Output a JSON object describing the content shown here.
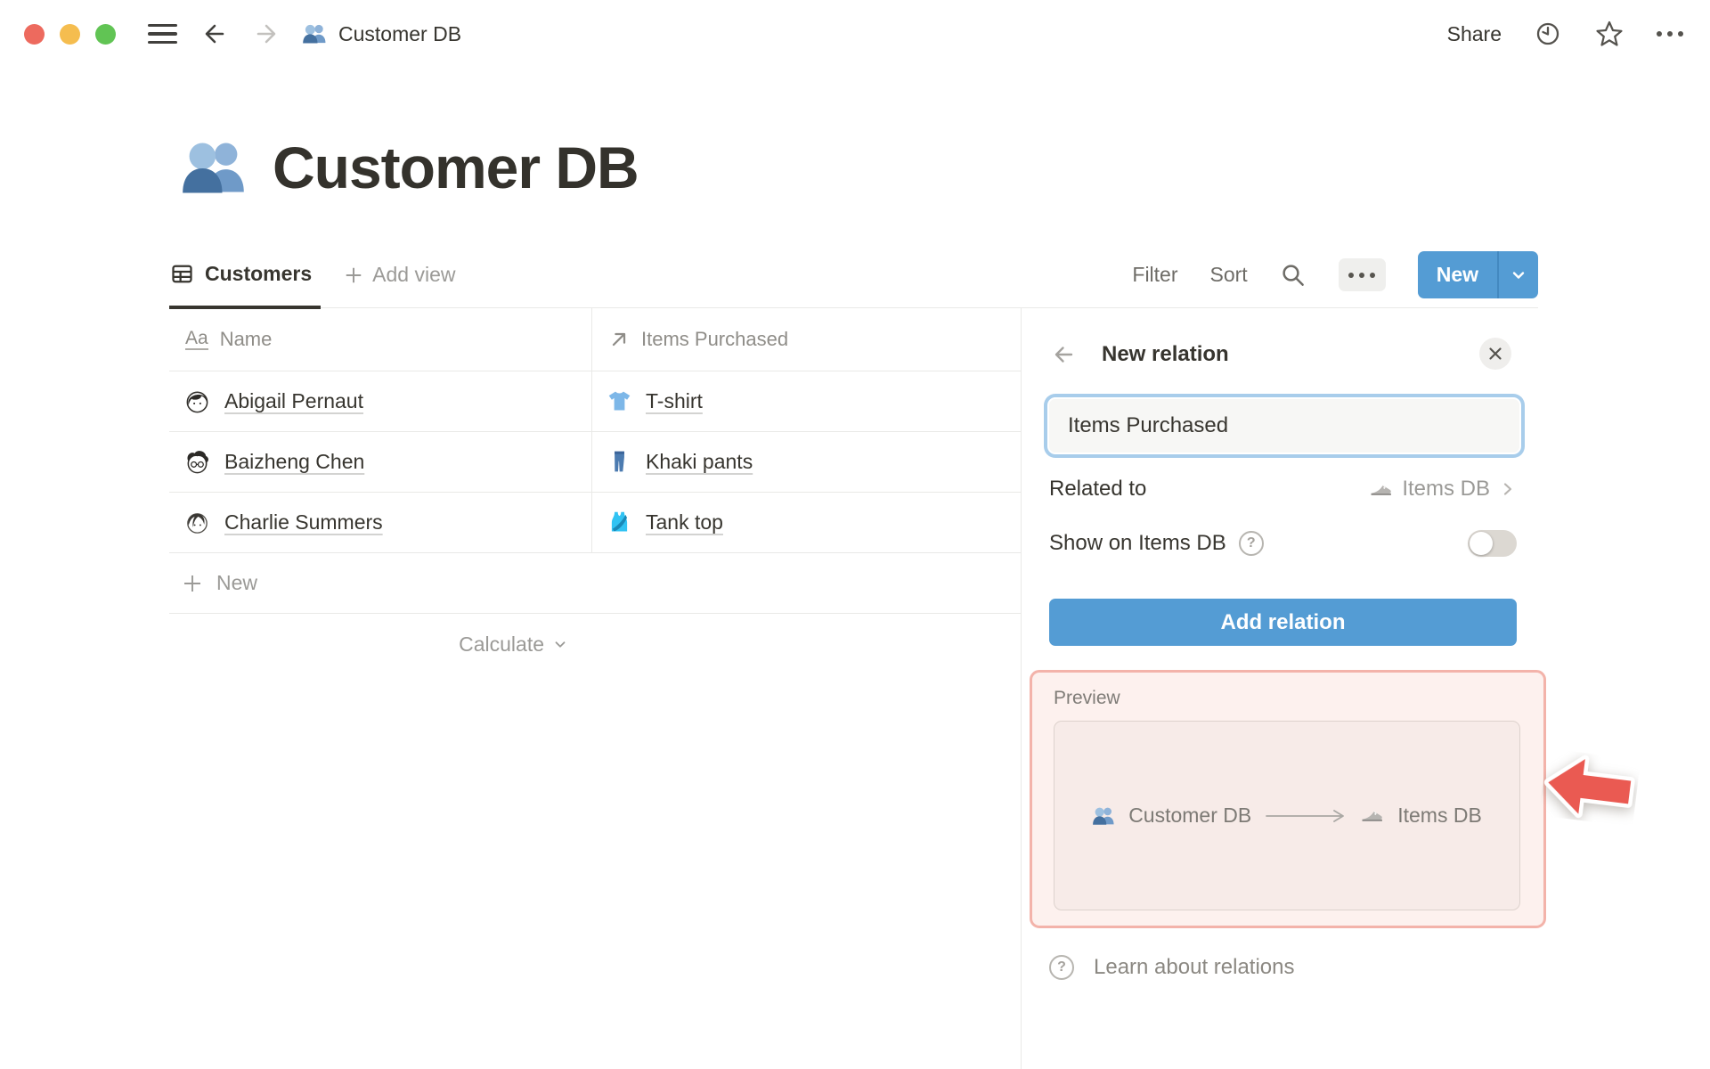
{
  "topbar": {
    "title": "Customer DB",
    "share": "Share"
  },
  "page": {
    "title": "Customer DB"
  },
  "toolbar": {
    "tab": "Customers",
    "add_view": "Add view",
    "filter": "Filter",
    "sort": "Sort",
    "new_label": "New"
  },
  "table": {
    "title_icon": "Aa",
    "columns": [
      {
        "label": "Name"
      },
      {
        "label": "Items Purchased"
      }
    ],
    "rows": [
      {
        "name": "Abigail Pernaut",
        "item": "T-shirt"
      },
      {
        "name": "Baizheng Chen",
        "item": "Khaki pants"
      },
      {
        "name": "Charlie Summers",
        "item": "Tank top"
      }
    ],
    "new_label": "New",
    "calculate": "Calculate"
  },
  "panel": {
    "title": "New relation",
    "input_value": "Items Purchased",
    "related_label": "Related to",
    "related_value": "Items DB",
    "show_label": "Show on Items DB",
    "help_glyph": "?",
    "add_label": "Add relation",
    "preview_label": "Preview",
    "preview_source": "Customer DB",
    "preview_target": "Items DB",
    "learn_label": "Learn about relations"
  },
  "colors": {
    "accent_blue": "#549cd4",
    "arrow_red": "#ea5a52",
    "pink_border": "#f3b3aa"
  }
}
